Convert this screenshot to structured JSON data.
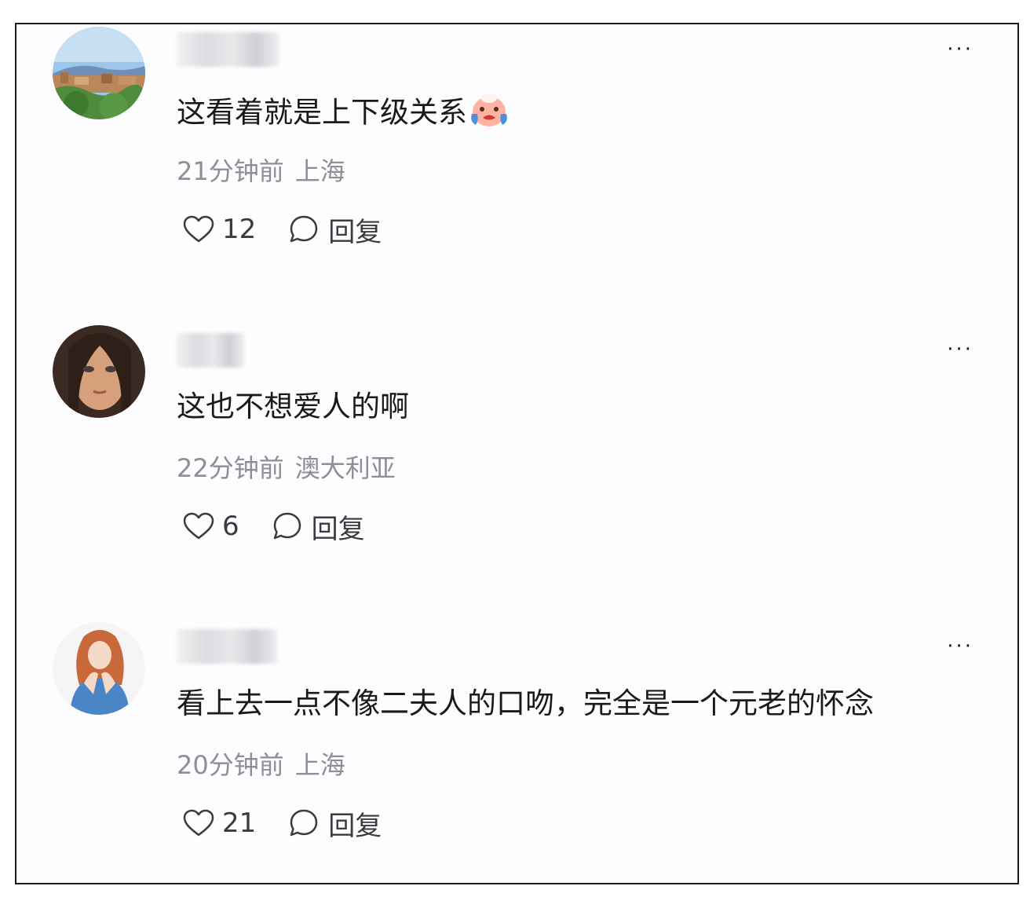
{
  "comments": [
    {
      "username": "",
      "content": "这看着就是上下级关系",
      "has_emoji": true,
      "emoji_icon": "crying-face-icon",
      "time": "21分钟前",
      "location": "上海",
      "likes": "12",
      "reply_label": "回复",
      "more_label": "···"
    },
    {
      "username": "",
      "content": "这也不想爱人的啊",
      "has_emoji": false,
      "time": "22分钟前",
      "location": "澳大利亚",
      "likes": "6",
      "reply_label": "回复",
      "more_label": "···"
    },
    {
      "username": "",
      "content": "看上去一点不像二夫人的口吻，完全是一个元老的怀念",
      "has_emoji": false,
      "time": "20分钟前",
      "location": "上海",
      "likes": "21",
      "reply_label": "回复",
      "more_label": "···"
    }
  ],
  "icons": {
    "like": "heart-outline-icon",
    "reply": "speech-bubble-icon",
    "more": "more-dots-icon"
  },
  "colors": {
    "text_primary": "#1a1a1a",
    "text_secondary": "#8e8e94",
    "icon": "#3b3b3f",
    "background": "#fdfdff"
  }
}
